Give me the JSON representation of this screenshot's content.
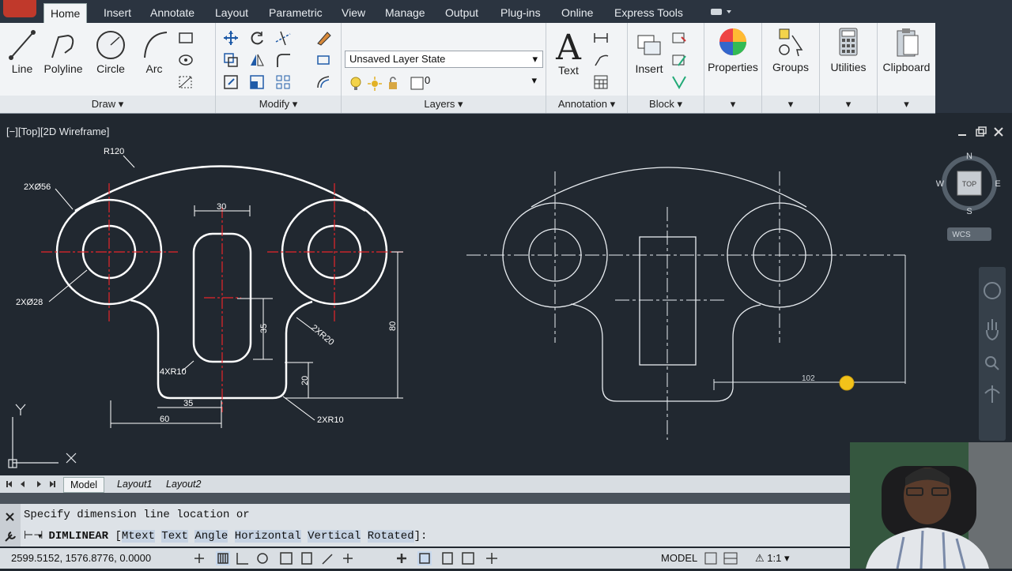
{
  "tabs": [
    "Home",
    "Insert",
    "Annotate",
    "Layout",
    "Parametric",
    "View",
    "Manage",
    "Output",
    "Plug-ins",
    "Online",
    "Express Tools"
  ],
  "draw": {
    "title": "Draw",
    "line": "Line",
    "polyline": "Polyline",
    "circle": "Circle",
    "arc": "Arc"
  },
  "modify": {
    "title": "Modify"
  },
  "layers": {
    "title": "Layers",
    "state": "Unsaved Layer State",
    "current": "0"
  },
  "annotation": {
    "title": "Annotation",
    "text": "Text"
  },
  "block": {
    "title": "Block",
    "insert": "Insert"
  },
  "properties": "Properties",
  "groups": "Groups",
  "utilities": "Utilities",
  "clipboard": "Clipboard",
  "viewport": {
    "label": "[−][Top][2D Wireframe]",
    "viewcube": {
      "n": "N",
      "s": "S",
      "e": "E",
      "w": "W",
      "top": "TOP",
      "wcs": "WCS"
    },
    "dims": {
      "r120": "R120",
      "d56": "2XØ56",
      "d28": "2XØ28",
      "w30": "30",
      "h35": "35",
      "r20": "2XR20",
      "h80": "80",
      "r10a": "4XR10",
      "h20": "20",
      "w35": "35",
      "w60": "60",
      "r10b": "2XR10",
      "live": "102"
    },
    "ucs_y": "Y"
  },
  "layout_tabs": [
    "Model",
    "Layout1",
    "Layout2"
  ],
  "command": {
    "prompt": "Specify dimension line location or",
    "name": "DIMLINEAR",
    "options_prefix": "[",
    "options": [
      "Mtext",
      "Text",
      "Angle",
      "Horizontal",
      "Vertical",
      "Rotated"
    ],
    "options_suffix": "]:"
  },
  "status": {
    "coords": "2599.5152, 1576.8776, 0.0000",
    "model": "MODEL",
    "scale": "1:1"
  }
}
